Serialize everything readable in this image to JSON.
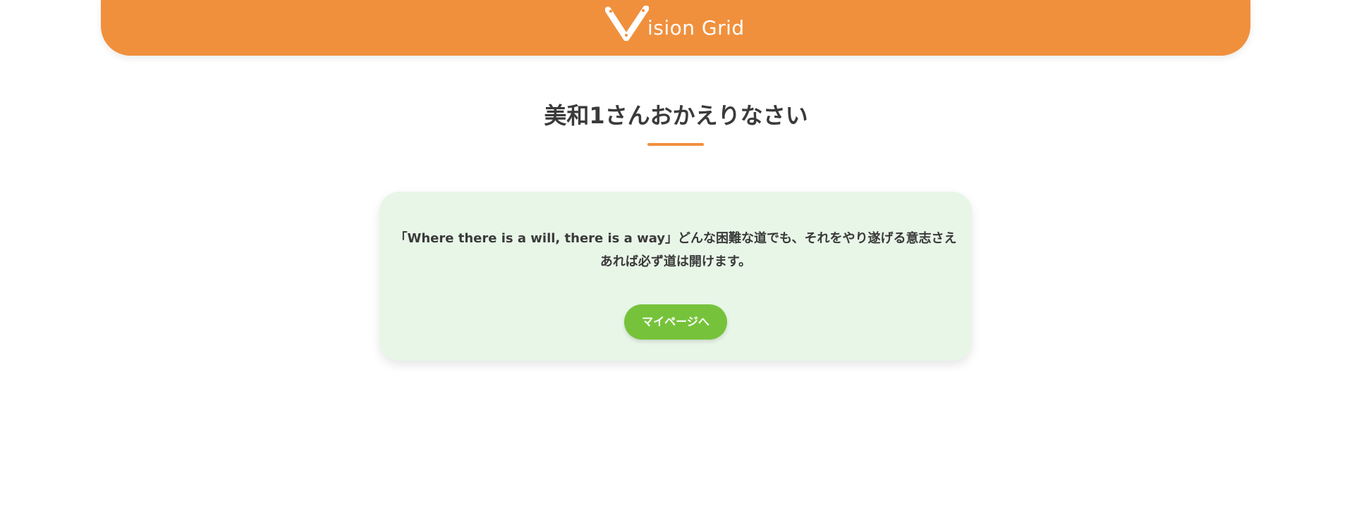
{
  "header": {
    "logo_text": "ision Grid",
    "logo_icon": "v-logo-icon",
    "accent_color": "#f0903d"
  },
  "main": {
    "title": "美和1さんおかえりなさい",
    "quote": "「Where there is a will, there is a way」どんな困難な道でも、それをやり遂げる意志さえあれば必ず道は開けます。",
    "mypage_button_label": "マイページへ",
    "card_color": "#e8f6e8",
    "button_color": "#76c33b"
  }
}
